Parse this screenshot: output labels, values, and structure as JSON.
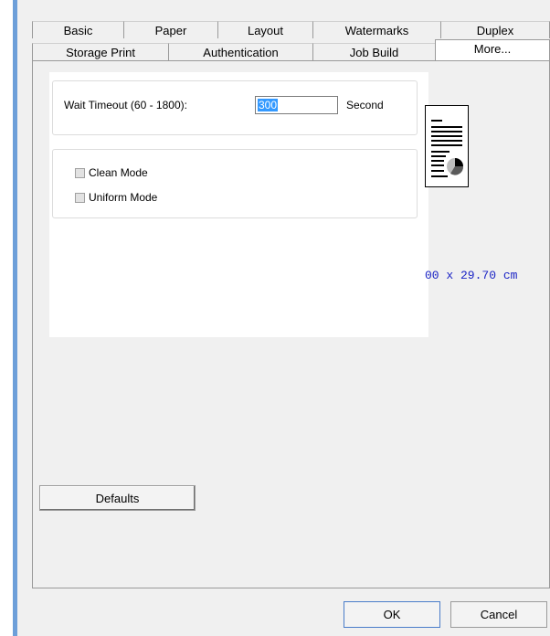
{
  "tabs_row1": [
    "Basic",
    "Paper",
    "Layout",
    "Watermarks",
    "Duplex"
  ],
  "tabs_row2": [
    "Storage Print",
    "Authentication",
    "Job Build",
    "More..."
  ],
  "active_tab": "More...",
  "wait_timeout": {
    "label": "Wait Timeout (60 - 1800):",
    "value": "300",
    "unit": "Second"
  },
  "modes": {
    "clean_mode": {
      "label": "Clean Mode",
      "checked": false
    },
    "uniform_mode": {
      "label": "Uniform Mode",
      "checked": false
    }
  },
  "paper_size_text": "00 x 29.70 cm",
  "buttons": {
    "defaults": "Defaults",
    "ok": "OK",
    "cancel": "Cancel"
  },
  "colors": {
    "accent": "#6d9fd9",
    "paper_size_text": "#1b24c5",
    "selection": "#3399ff"
  },
  "icons": [
    "document-preview-icon"
  ]
}
